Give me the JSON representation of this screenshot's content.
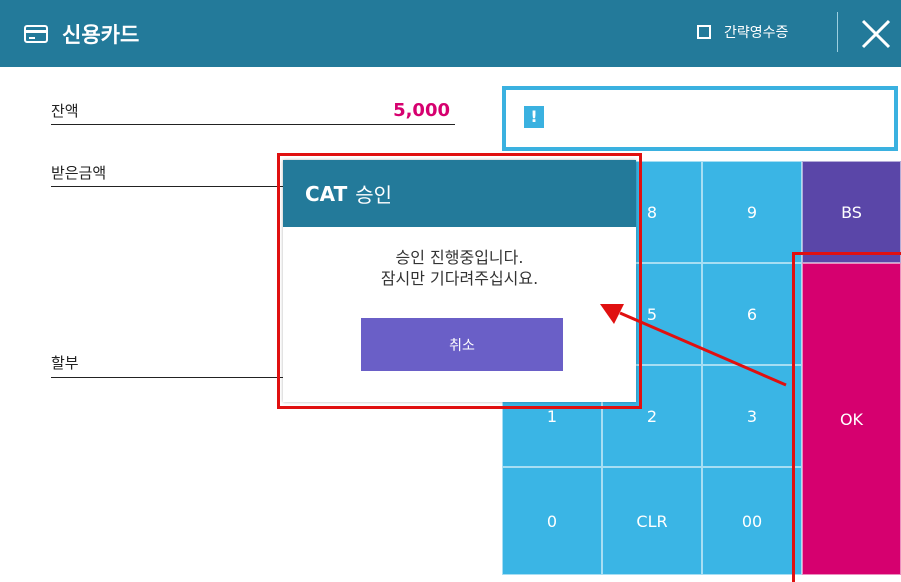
{
  "header": {
    "title": "신용카드",
    "receipt_label": "간략영수증",
    "icon": "credit-card-icon",
    "close_icon": "close-icon"
  },
  "form": {
    "balance_label": "잔액",
    "balance_value": "5,000",
    "received_label": "받은금액",
    "installment_label": "할부"
  },
  "message": {
    "icon": "warning-icon"
  },
  "keypad": {
    "k8": "8",
    "k9": "9",
    "bs": "BS",
    "k5": "5",
    "k6": "6",
    "k1": "1",
    "k2": "2",
    "k3": "3",
    "ok": "OK",
    "k0": "0",
    "clr": "CLR",
    "k00": "00"
  },
  "dialog": {
    "title_bold": "CAT",
    "title_rest": "승인",
    "line1": "승인 진행중입니다.",
    "line2": "잠시만 기다려주십시요.",
    "cancel": "취소"
  },
  "colors": {
    "header": "#237a9a",
    "key": "#3ab5e5",
    "bs": "#5a46a8",
    "ok": "#d6006f",
    "cancel": "#6a5fc7",
    "highlight": "#e01010"
  }
}
